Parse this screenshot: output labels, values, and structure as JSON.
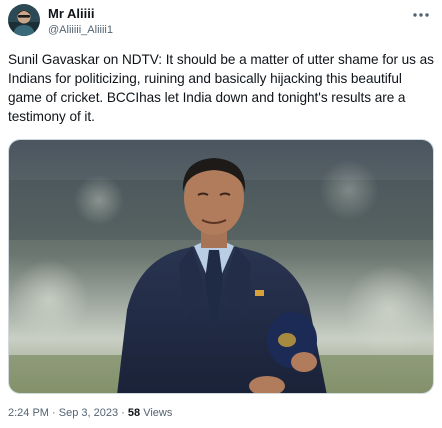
{
  "author": {
    "display_name": "Mr Aliiii",
    "handle": "@Aliiiii_Aliiii1",
    "avatar_icon": "avatar-icon",
    "more_icon": "more-dots-icon"
  },
  "tweet": {
    "text": "Sunil Gavaskar on NDTV: It should be a matter of utter shame for us as Indians for politicizing, ruining and basically hijacking this beautiful game of cricket. BCCIhas let India down and tonight's results are a testimony of it."
  },
  "media": {
    "kind": "photo"
  },
  "meta": {
    "time": "2:24 PM",
    "separator": "·",
    "date": "Sep 3, 2023",
    "views_count": "58",
    "views_label": "Views"
  },
  "colors": {
    "text_primary": "#0f1419",
    "text_secondary": "#536471",
    "border": "#cfd9de"
  }
}
